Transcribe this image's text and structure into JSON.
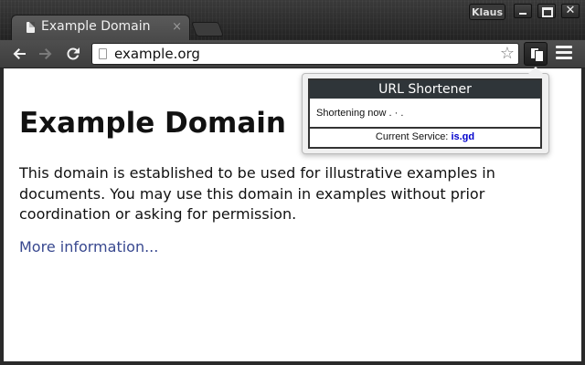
{
  "browser": {
    "tab_title": "Example Domain",
    "tab_close": "×",
    "profile_name": "Klaus",
    "address": "example.org"
  },
  "toolbar": {
    "back_glyph": "🡐",
    "forward_glyph": "🡒",
    "reload_glyph": "↻",
    "star_glyph": "☆"
  },
  "page": {
    "title": "Example Domain",
    "paragraph": "This domain is established to be used for illustrative examples in documents. You may use this domain in examples without prior coordination or asking for permission.",
    "link_text": "More information..."
  },
  "popup": {
    "header": "URL Shortener",
    "status": "Shortening now . · .",
    "service_label": "Current Service:",
    "service_value": "is.gd"
  },
  "colors": {
    "link": "#38488f",
    "service": "#0000cc",
    "popup_header": "#2f3539"
  }
}
